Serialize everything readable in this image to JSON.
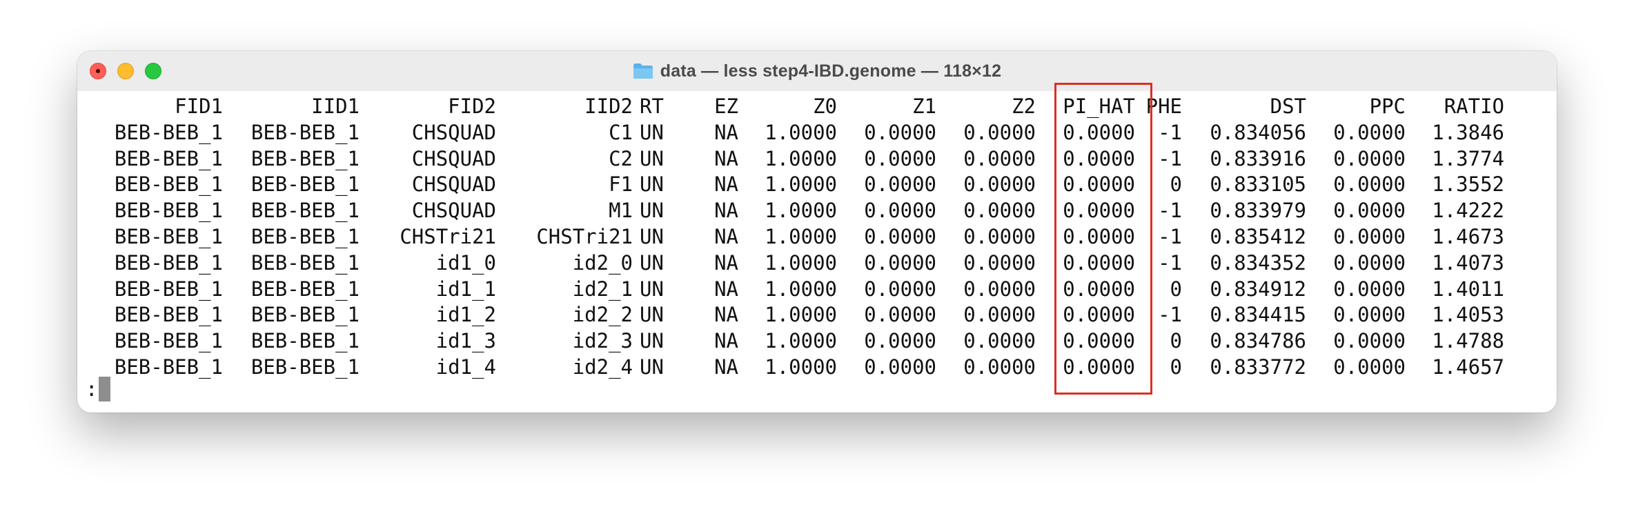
{
  "window": {
    "title": "data — less step4-IBD.genome — 118×12",
    "folder_icon": "folder-icon",
    "controls": [
      "close",
      "minimize",
      "maximize"
    ]
  },
  "table": {
    "headers": [
      "FID1",
      "IID1",
      "FID2",
      "IID2",
      "RT",
      "EZ",
      "Z0",
      "Z1",
      "Z2",
      "PI_HAT",
      "PHE",
      "DST",
      "PPC",
      "RATIO"
    ],
    "rows": [
      [
        "BEB-BEB_1",
        "BEB-BEB_1",
        "CHSQUAD",
        "C1",
        "UN",
        "NA",
        "1.0000",
        "0.0000",
        "0.0000",
        "0.0000",
        "-1",
        "0.834056",
        "0.0000",
        "1.3846"
      ],
      [
        "BEB-BEB_1",
        "BEB-BEB_1",
        "CHSQUAD",
        "C2",
        "UN",
        "NA",
        "1.0000",
        "0.0000",
        "0.0000",
        "0.0000",
        "-1",
        "0.833916",
        "0.0000",
        "1.3774"
      ],
      [
        "BEB-BEB_1",
        "BEB-BEB_1",
        "CHSQUAD",
        "F1",
        "UN",
        "NA",
        "1.0000",
        "0.0000",
        "0.0000",
        "0.0000",
        "0",
        "0.833105",
        "0.0000",
        "1.3552"
      ],
      [
        "BEB-BEB_1",
        "BEB-BEB_1",
        "CHSQUAD",
        "M1",
        "UN",
        "NA",
        "1.0000",
        "0.0000",
        "0.0000",
        "0.0000",
        "-1",
        "0.833979",
        "0.0000",
        "1.4222"
      ],
      [
        "BEB-BEB_1",
        "BEB-BEB_1",
        "CHSTri21",
        "CHSTri21",
        "UN",
        "NA",
        "1.0000",
        "0.0000",
        "0.0000",
        "0.0000",
        "-1",
        "0.835412",
        "0.0000",
        "1.4673"
      ],
      [
        "BEB-BEB_1",
        "BEB-BEB_1",
        "id1_0",
        "id2_0",
        "UN",
        "NA",
        "1.0000",
        "0.0000",
        "0.0000",
        "0.0000",
        "-1",
        "0.834352",
        "0.0000",
        "1.4073"
      ],
      [
        "BEB-BEB_1",
        "BEB-BEB_1",
        "id1_1",
        "id2_1",
        "UN",
        "NA",
        "1.0000",
        "0.0000",
        "0.0000",
        "0.0000",
        "0",
        "0.834912",
        "0.0000",
        "1.4011"
      ],
      [
        "BEB-BEB_1",
        "BEB-BEB_1",
        "id1_2",
        "id2_2",
        "UN",
        "NA",
        "1.0000",
        "0.0000",
        "0.0000",
        "0.0000",
        "-1",
        "0.834415",
        "0.0000",
        "1.4053"
      ],
      [
        "BEB-BEB_1",
        "BEB-BEB_1",
        "id1_3",
        "id2_3",
        "UN",
        "NA",
        "1.0000",
        "0.0000",
        "0.0000",
        "0.0000",
        "0",
        "0.834786",
        "0.0000",
        "1.4788"
      ],
      [
        "BEB-BEB_1",
        "BEB-BEB_1",
        "id1_4",
        "id2_4",
        "UN",
        "NA",
        "1.0000",
        "0.0000",
        "0.0000",
        "0.0000",
        "0",
        "0.833772",
        "0.0000",
        "1.4657"
      ]
    ],
    "highlighted_column": "PI_HAT",
    "highlight_color": "#d93025"
  },
  "prompt": {
    "text": ":"
  },
  "colors": {
    "close": "#fe5f57",
    "minimize": "#febc2e",
    "maximize": "#28c840",
    "folder": "#5ab2e8"
  }
}
